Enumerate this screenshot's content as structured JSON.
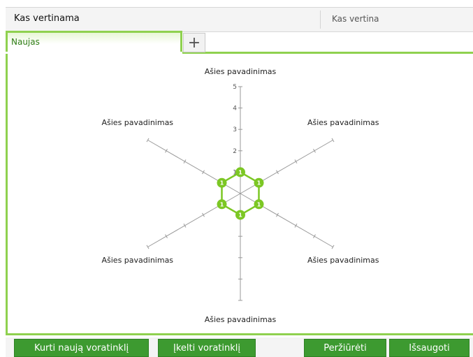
{
  "header": {
    "left_title": "Kas vertinama",
    "right_title": "Kas vertina"
  },
  "tabs": [
    {
      "label": "Naujas",
      "active": true
    }
  ],
  "add_tab_symbol": "+",
  "chart_data": {
    "type": "radar",
    "axes": [
      "Ašies pavadinimas",
      "Ašies pavadinimas",
      "Ašies pavadinimas",
      "Ašies pavadinimas",
      "Ašies pavadinimas",
      "Ašies pavadinimas"
    ],
    "scale_ticks": [
      "1",
      "2",
      "3",
      "4",
      "5"
    ],
    "range": [
      0,
      5
    ],
    "series": [
      {
        "values": [
          1,
          1,
          1,
          1,
          1,
          1
        ],
        "point_labels": [
          "1",
          "1",
          "1",
          "1",
          "1",
          "1"
        ]
      }
    ],
    "colors": {
      "series": "#7cc724",
      "axes": "#9a9a9a"
    }
  },
  "buttons": {
    "create": "Kurti naują voratinklį",
    "upload": "Įkelti voratinklį",
    "preview": "Peržiūrėti",
    "save": "Išsaugoti"
  },
  "accent_color": "#8fd14f"
}
